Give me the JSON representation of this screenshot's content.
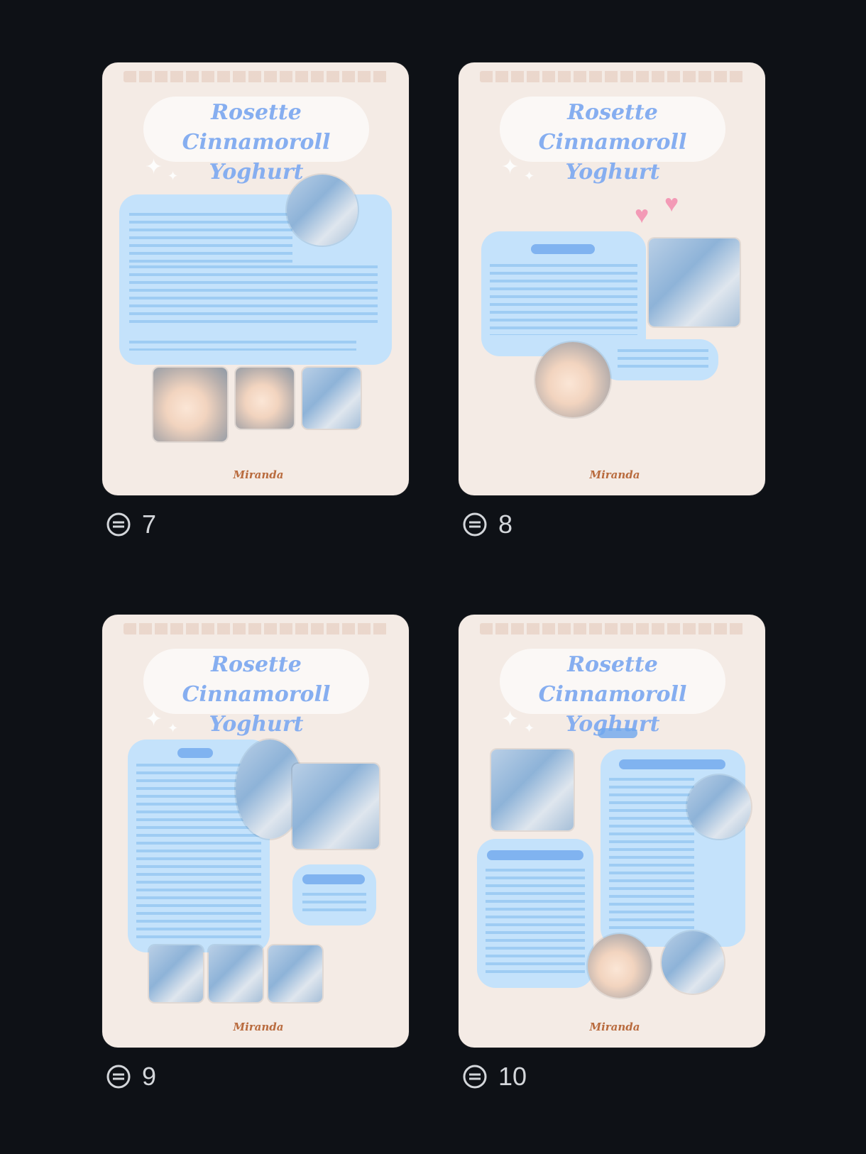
{
  "pages": [
    {
      "number": "7",
      "title": "Rosette Cinnamoroll\nYoghurt",
      "signature": "Miranda"
    },
    {
      "number": "8",
      "title": "Rosette Cinnamoroll\nYoghurt",
      "signature": "Miranda"
    },
    {
      "number": "9",
      "title": "Rosette Cinnamoroll\nYoghurt",
      "signature": "Miranda"
    },
    {
      "number": "10",
      "title": "Rosette Cinnamoroll\nYoghurt",
      "signature": "Miranda"
    }
  ],
  "icons": {
    "comment": "comment-icon",
    "sparkle": "sparkle-icon",
    "heart": "heart-icon"
  },
  "colors": {
    "background": "#0e1116",
    "card": "#f4ebe5",
    "panel": "#c4e2fb",
    "title": "#86aef0",
    "signature": "#b96b3e"
  }
}
